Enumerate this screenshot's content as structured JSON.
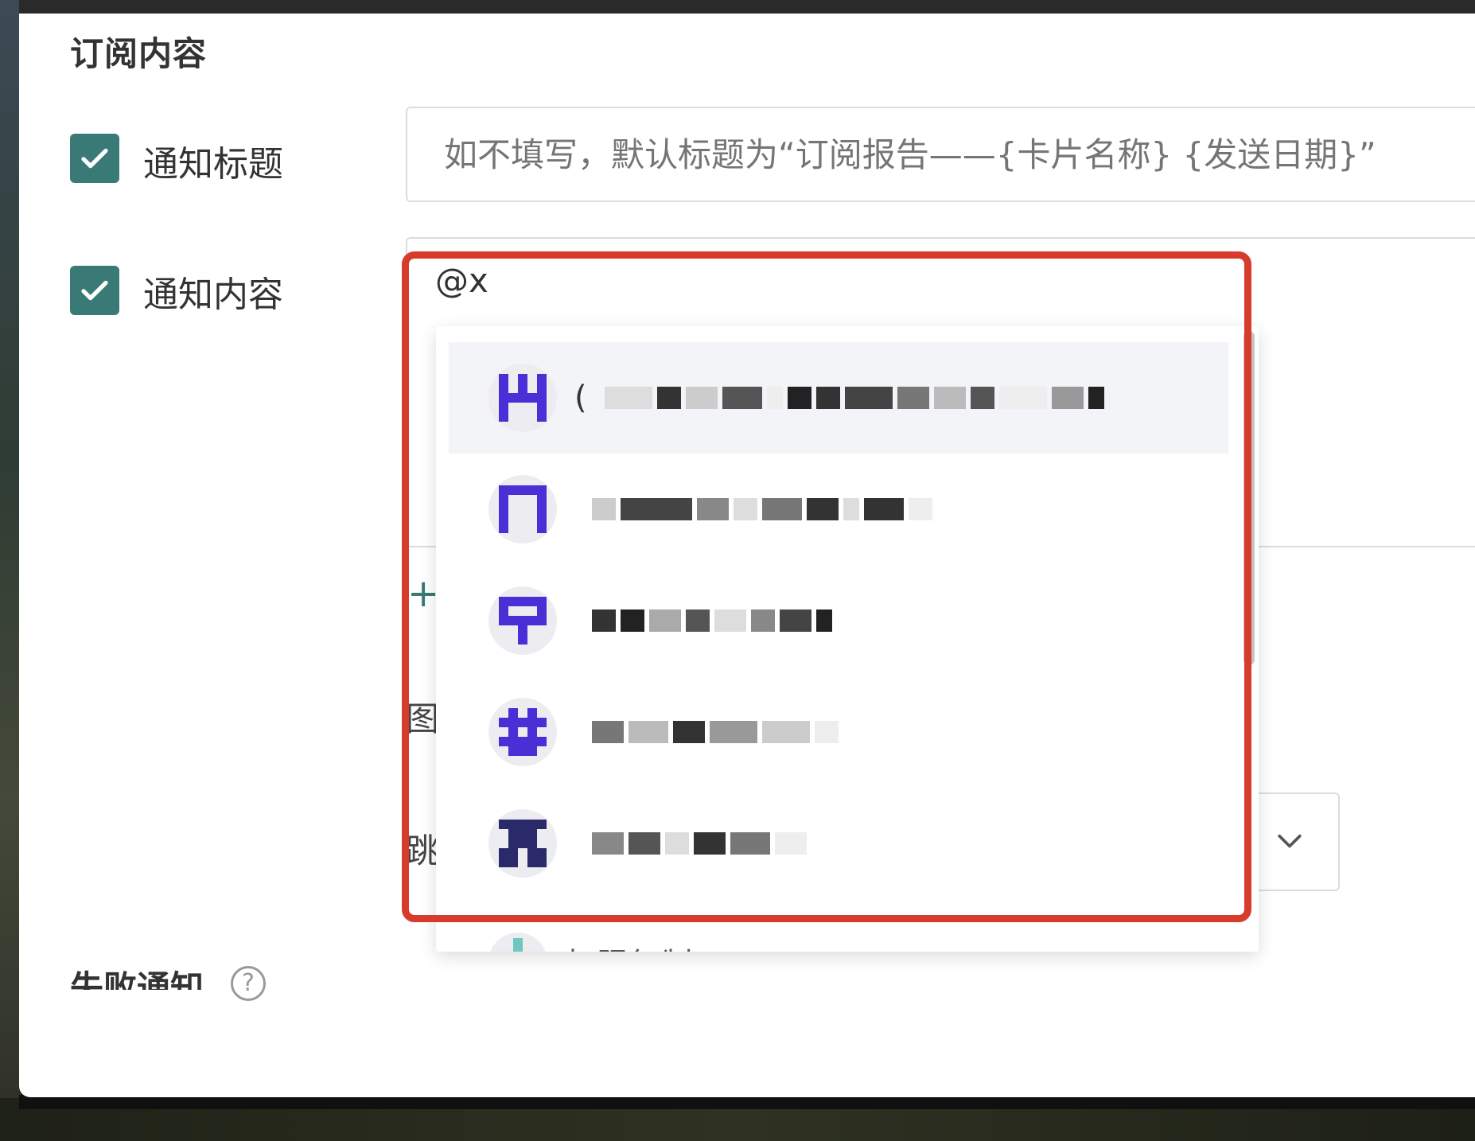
{
  "section": {
    "title": "订阅内容"
  },
  "fields": {
    "title_label": "通知标题",
    "title_placeholder": "如不填写，默认标题为“订阅报告——{卡片名称} {发送日期}”",
    "content_label": "通知内容",
    "content_value": "@x"
  },
  "side_chars": {
    "plus": "+",
    "image": "图",
    "jump": "跳"
  },
  "fail_section": {
    "title": "失败通知",
    "help": "?"
  },
  "mention_dropdown": {
    "items": [
      {
        "avatar_icon": "pixel-avatar-icon",
        "label_prefix": "(",
        "active": true
      },
      {
        "avatar_icon": "pixel-avatar-icon",
        "label_prefix": ""
      },
      {
        "avatar_icon": "pixel-avatar-icon",
        "label_prefix": ""
      },
      {
        "avatar_icon": "pixel-avatar-icon",
        "label_prefix": ""
      },
      {
        "avatar_icon": "pixel-avatar-icon",
        "label_prefix": ""
      }
    ],
    "partial_item_label": "权限复制"
  },
  "colors": {
    "accent": "#3a7a76",
    "highlight": "#d63b2b",
    "avatar_fg": "#4a2fd6"
  }
}
